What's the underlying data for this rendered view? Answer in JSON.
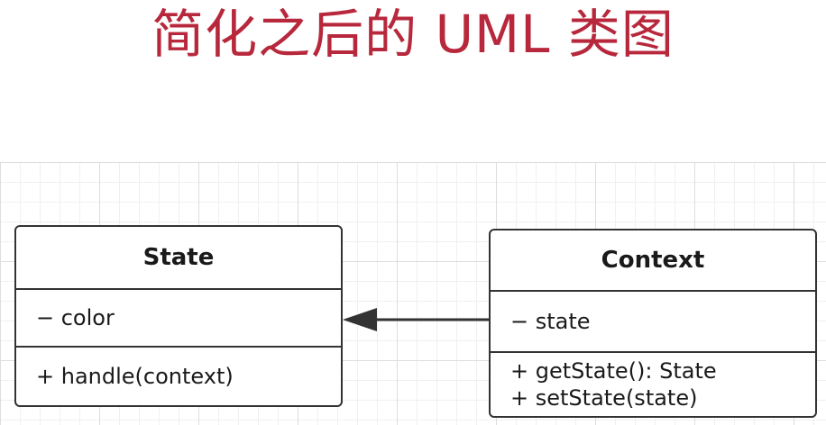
{
  "title": "简化之后的 UML 类图",
  "colors": {
    "title": "#b8283c",
    "stroke": "#333333"
  },
  "classes": {
    "state": {
      "name": "State",
      "attributes": [
        "− color"
      ],
      "operations": [
        "+ handle(context)"
      ]
    },
    "context": {
      "name": "Context",
      "attributes": [
        "− state"
      ],
      "operations": [
        "+ getState(): State",
        "+ setState(state)"
      ]
    }
  },
  "relation": {
    "from": "Context",
    "to": "State",
    "arrow": "filled-triangle"
  }
}
